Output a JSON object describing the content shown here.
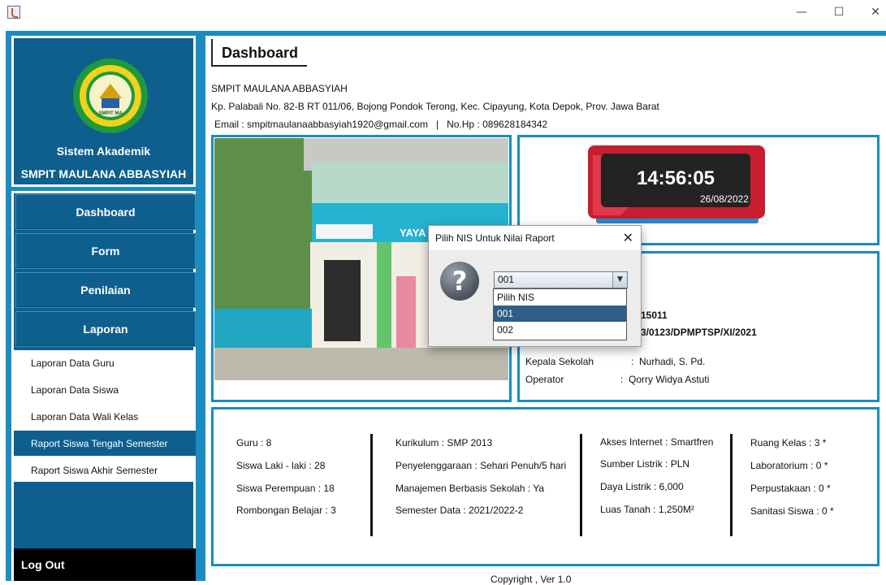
{
  "window": {
    "minimize_glyph": "—",
    "maximize_glyph": "☐",
    "close_glyph": "✕"
  },
  "sidebar": {
    "app_title_line1": "Sistem Akademik",
    "app_title_line2": "SMPIT MAULANA ABBASYIAH",
    "logo_text": "SMPIT MA",
    "menu": [
      {
        "label": "Dashboard"
      },
      {
        "label": "Form"
      },
      {
        "label": "Penilaian"
      },
      {
        "label": "Laporan"
      }
    ],
    "submenu": [
      {
        "label": "Laporan Data Guru"
      },
      {
        "label": "Laporan Data Siswa"
      },
      {
        "label": "Laporan Data Wali Kelas"
      },
      {
        "label": "Raport Siswa Tengah Semester"
      },
      {
        "label": "Raport Siswa Akhir Semester"
      }
    ],
    "logout_label": "Log Out"
  },
  "header": {
    "title": "Dashboard",
    "school_name": "SMPIT MAULANA ABBASYIAH",
    "address": "Kp. Palabali No. 82-B RT 011/06, Bojong Pondok Terong, Kec. Cipayung, Kota Depok, Prov. Jawa Barat",
    "contact": "Email : smpitmaulanaabbasyiah1920@gmail.com   |   No.Hp : 089628184342"
  },
  "photo": {
    "sign_text": "YAYA"
  },
  "clock": {
    "time": "14:56:05",
    "date": "26/08/2022"
  },
  "details": {
    "partial_npsn": "15011",
    "partial_permit": "3/0123/DPMPTSP/XI/2021",
    "kepala_label": "Kepala Sekolah",
    "kepala_value": ":  Nurhadi, S. Pd.",
    "operator_label": "Operator",
    "operator_value": ":  Qorry Widya Astuti"
  },
  "stats": {
    "col1": [
      "Guru : 8",
      "Siswa Laki - laki : 28",
      "Siswa Perempuan : 18",
      "Rombongan Belajar : 3"
    ],
    "col2": [
      "Kurikulum : SMP 2013",
      "Penyelenggaraan : Sehari Penuh/5 hari",
      "Manajemen Berbasis Sekolah : Ya",
      "Semester Data : 2021/2022-2"
    ],
    "col3": [
      "Akses Internet : Smartfren",
      "Sumber Listrik : PLN",
      "Daya Listrik : 6,000",
      "Luas Tanah : 1,250M²"
    ],
    "col4": [
      "Ruang Kelas : 3 *",
      "Laboratorium : 0 *",
      "Perpustakaan : 0 *",
      "Sanitasi Siswa : 0 *"
    ]
  },
  "dialog": {
    "title": "Pilih NIS Untuk Nilai Raport",
    "close_glyph": "✕",
    "question_glyph": "?",
    "selected_value": "001",
    "arrow_glyph": "▼",
    "options": [
      "Pilih NIS",
      "001",
      "002"
    ]
  },
  "footer": {
    "copyright": "Copyright , Ver 1.0"
  },
  "colors": {
    "accent_blue": "#1a8cc0",
    "panel_dark_blue": "#0f5f8e",
    "selected_option": "#2f5e86"
  }
}
